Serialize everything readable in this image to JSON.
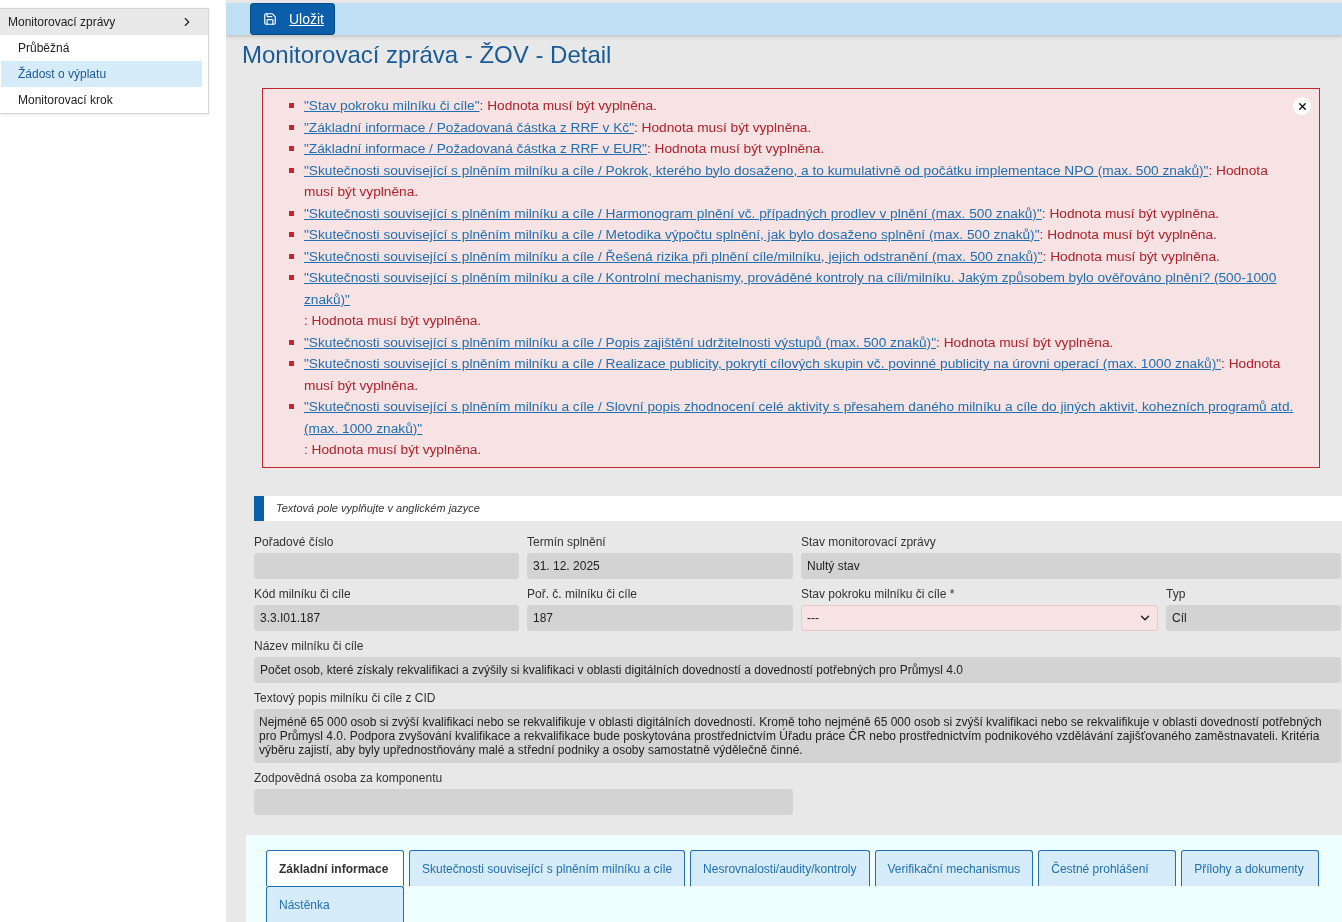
{
  "sidebar": {
    "header": "Monitorovací zprávy",
    "items": [
      {
        "label": "Průběžná",
        "selected": false
      },
      {
        "label": "Žádost o výplatu",
        "selected": true
      },
      {
        "label": "Monitorovací krok",
        "selected": false
      }
    ]
  },
  "toolbar": {
    "save_button": "Uložit"
  },
  "title": "Monitorovací zpráva - ŽOV - Detail",
  "errors": [
    {
      "field": "\"Stav pokroku milníku či cíle\"",
      "message": ": Hodnota musí být vyplněna."
    },
    {
      "field": "\"Základní informace / Požadovaná částka z RRF v Kč\"",
      "message": ": Hodnota musí být vyplněna."
    },
    {
      "field": "\"Základní informace / Požadovaná částka z RRF v EUR\"",
      "message": ": Hodnota musí být vyplněna."
    },
    {
      "field": "\"Skutečnosti související s plněním milníku a cíle / Pokrok, kterého bylo dosaženo, a to kumulativně od počátku implementace NPO (max. 500 znaků)\"",
      "message": ": Hodnota musí být vyplněna."
    },
    {
      "field": "\"Skutečnosti související s plněním milníku a cíle / Harmonogram plnění vč. případných prodlev v plnění (max. 500 znaků)\"",
      "message": ": Hodnota musí být vyplněna."
    },
    {
      "field": "\"Skutečnosti související s plněním milníku a cíle / Metodika výpočtu splnění, jak bylo dosaženo splnění (max. 500 znaků)\"",
      "message": ": Hodnota musí být vyplněna."
    },
    {
      "field": "\"Skutečnosti související s plněním milníku a cíle / Řešená rizika při plnění cíle/milníku, jejich odstranění (max. 500 znaků)\"",
      "message": ": Hodnota musí být vyplněna."
    },
    {
      "field": "\"Skutečnosti související s plněním milníku a cíle / Kontrolní mechanismy, prováděné kontroly na cíli/milníku. Jakým způsobem bylo ověřováno plnění? (500-1000 znaků)\"",
      "message": ": Hodnota musí být vyplněna."
    },
    {
      "field": "\"Skutečnosti související s plněním milníku a cíle / Popis zajištění udržitelnosti výstupů (max. 500 znaků)\"",
      "message": ": Hodnota musí být vyplněna."
    },
    {
      "field": "\"Skutečnosti související s plněním milníku a cíle / Realizace publicity, pokrytí cílových skupin vč. povinné publicity na úrovni operací (max. 1000 znaků)\"",
      "message": ": Hodnota musí být vyplněna."
    },
    {
      "field": "\"Skutečnosti související s plněním milníku a cíle / Slovní popis zhodnocení celé aktivity s přesahem daného milníku a cíle do jiných aktivit, kohezních programů atd. (max. 1000 znaků)\"",
      "message": ": Hodnota musí být vyplněna."
    }
  ],
  "info_note": "Textová pole vyplňujte v anglickém jazyce",
  "field_rows": [
    [
      {
        "label": "Pořadové číslo",
        "kind": "text",
        "invalid": false
      },
      {
        "label": "Termín splnění",
        "kind": "text",
        "value": "31. 12. 2025",
        "invalid": false
      },
      {
        "label": "Stav monitorovací zprávy",
        "kind": "text",
        "value": "Nultý stav",
        "invalid": false
      }
    ],
    [
      {
        "label": "Kód milníku či cíle",
        "kind": "text",
        "value": "3.3.I01.187",
        "invalid": false
      },
      {
        "label": "Poř. č. milníku či cíle",
        "kind": "text",
        "value": "187",
        "invalid": false
      },
      {
        "label": "Stav pokroku milníku či cíle *",
        "kind": "select",
        "value": "---",
        "invalid": true
      },
      {
        "label": "Typ",
        "kind": "text",
        "value": "Cíl",
        "invalid": false
      }
    ],
    [
      {
        "label": "Název milníku či cíle",
        "kind": "text",
        "value": "Počet osob, které získaly rekvalifikaci a zvýšily si kvalifikaci v oblasti digitálních dovedností a dovedností potřebných pro Průmysl 4.0",
        "invalid": false
      }
    ],
    [
      {
        "label": "Textový popis milníku či cíle z CID",
        "kind": "textarea",
        "value": "Nejméně 65 000 osob si zvýší kvalifikaci nebo se rekvalifikuje v oblasti digitálních dovedností. Kromě toho nejméně 65 000 osob si zvýší kvalifikaci nebo se rekvalifikuje v oblasti dovedností potřebných pro Průmysl 4.0. Podpora zvyšování kvalifikace a rekvalifikace bude poskytována prostřednictvím Úřadu práce ČR nebo prostřednictvím podnikového vzdělávání zajišťovaného zaměstnavateli. Kritéria výběru zajistí, aby byly upřednostňovány malé a střední podniky a osoby samostatně výdělečně činné.",
        "invalid": false
      }
    ],
    [
      {
        "label": "Zodpovědná osoba za komponentu",
        "kind": "text",
        "invalid": false
      }
    ]
  ],
  "tabs": [
    {
      "label": "Základní informace",
      "selected": true
    },
    {
      "label": "Skutečnosti související s plněním milníku a cíle",
      "selected": false
    },
    {
      "label": "Nesrovnalosti/audity/kontroly",
      "selected": false
    },
    {
      "label": "Verifikační mechanismus",
      "selected": false
    },
    {
      "label": "Čestné prohlášení",
      "selected": false
    },
    {
      "label": "Přílohy a dokumenty",
      "selected": false
    },
    {
      "label": "Nástěnka",
      "selected": false
    }
  ]
}
